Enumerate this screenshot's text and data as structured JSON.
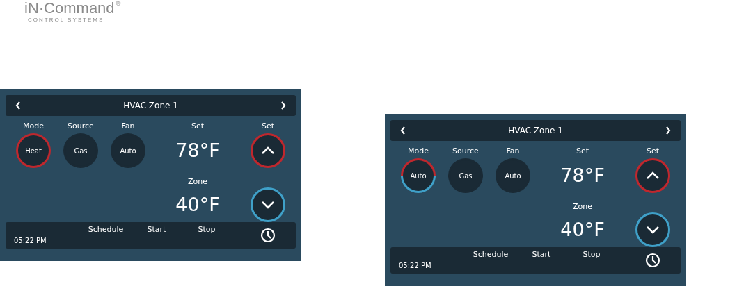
{
  "logo": {
    "name": "iN·Command",
    "registered": "®",
    "tagline": "CONTROL SYSTEMS"
  },
  "panels": [
    {
      "title": "HVAC Zone 1",
      "controls": [
        {
          "label": "Mode",
          "value": "Heat",
          "kind": "heat"
        },
        {
          "label": "Source",
          "value": "Gas",
          "kind": "plain"
        },
        {
          "label": "Fan",
          "value": "Auto",
          "kind": "plain"
        }
      ],
      "set_label": "Set",
      "setpoint": "78°F",
      "zone_label": "Zone",
      "zone_temp": "40°F",
      "button_label": "Set",
      "footer": {
        "time": "05:22 PM",
        "items": [
          "Schedule",
          "Start",
          "Stop"
        ]
      }
    },
    {
      "title": "HVAC Zone 1",
      "controls": [
        {
          "label": "Mode",
          "value": "Auto",
          "kind": "auto"
        },
        {
          "label": "Source",
          "value": "Gas",
          "kind": "plain"
        },
        {
          "label": "Fan",
          "value": "Auto",
          "kind": "plain"
        }
      ],
      "set_label": "Set",
      "setpoint": "78°F",
      "zone_label": "Zone",
      "zone_temp": "40°F",
      "button_label": "Set",
      "footer": {
        "time": "05:22 PM",
        "items": [
          "Schedule",
          "Start",
          "Stop"
        ]
      }
    }
  ]
}
